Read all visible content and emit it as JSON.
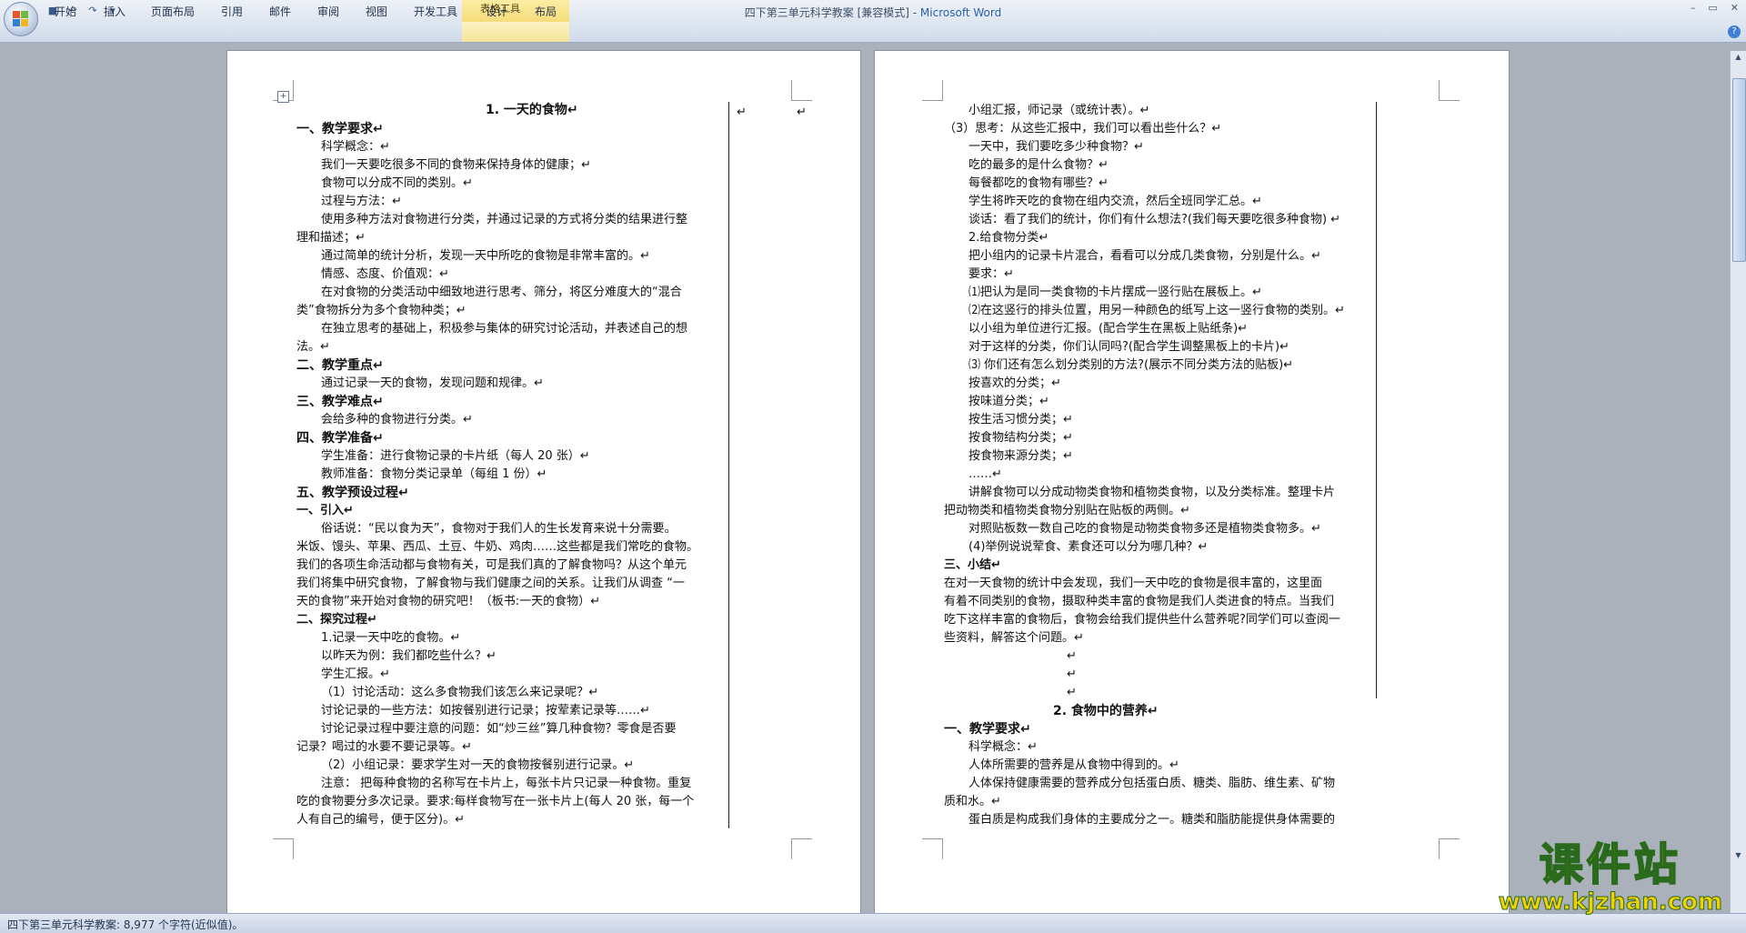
{
  "window": {
    "doc_name": "四下第三单元科学教案 [兼容模式] - ",
    "app_name": "Microsoft Word",
    "context_tab_group": "表格工具",
    "controls": {
      "minimize": "–",
      "maximize": "▭",
      "close": "✕"
    }
  },
  "qat": {
    "save": "■",
    "undo": "↶",
    "redo": "↷",
    "more": "▾"
  },
  "ribbon_tabs": [
    "开始",
    "插入",
    "页面布局",
    "引用",
    "邮件",
    "审阅",
    "视图",
    "开发工具",
    "设计",
    "布局"
  ],
  "help": "?",
  "move_handle": "+",
  "page1": {
    "title": "1.    一天的食物↵",
    "side_marks": [
      "↵",
      "↵"
    ],
    "lines": [
      {
        "t": "一、教学要求↵",
        "s": "h"
      },
      {
        "t": "科学概念：↵",
        "i": 1
      },
      {
        "t": "我们一天要吃很多不同的食物来保持身体的健康；↵",
        "i": 1
      },
      {
        "t": "食物可以分成不同的类别。↵",
        "i": 1
      },
      {
        "t": "过程与方法：↵",
        "i": 1
      },
      {
        "t": "使用多种方法对食物进行分类，并通过记录的方式将分类的结果进行整",
        "i": 1
      },
      {
        "t": "理和描述；↵"
      },
      {
        "t": "通过简单的统计分析，发现一天中所吃的食物是非常丰富的。↵",
        "i": 1
      },
      {
        "t": "情感、态度、价值观：↵",
        "i": 1
      },
      {
        "t": "在对食物的分类活动中细致地进行思考、筛分，将区分难度大的“混合",
        "i": 1
      },
      {
        "t": "类”食物拆分为多个食物种类；↵"
      },
      {
        "t": "在独立思考的基础上，积极参与集体的研究讨论活动，并表述自己的想",
        "i": 1
      },
      {
        "t": "法。↵"
      },
      {
        "t": "二、教学重点↵",
        "s": "h"
      },
      {
        "t": "通过记录一天的食物，发现问题和规律。↵",
        "i": 1
      },
      {
        "t": "三、教学难点↵",
        "s": "h"
      },
      {
        "t": "会给多种的食物进行分类。↵",
        "i": 1
      },
      {
        "t": "四、教学准备↵",
        "s": "h"
      },
      {
        "t": "学生准备：进行食物记录的卡片纸（每人 20 张）↵",
        "i": 1
      },
      {
        "t": "教师准备：食物分类记录单（每组 1 份）↵",
        "i": 1
      },
      {
        "t": "五、教学预设过程↵",
        "s": "h"
      },
      {
        "t": "一、引入↵",
        "s": "b"
      },
      {
        "t": "俗话说：“民以食为天”，食物对于我们人的生长发育来说十分需要。",
        "i": 1
      },
      {
        "t": "米饭、馒头、苹果、西瓜、土豆、牛奶、鸡肉……这些都是我们常吃的食物。"
      },
      {
        "t": "我们的各项生命活动都与食物有关，可是我们真的了解食物吗？从这个单元"
      },
      {
        "t": "我们将集中研究食物，了解食物与我们健康之间的关系。让我们从调查 “一"
      },
      {
        "t": "天的食物”来开始对食物的研究吧！（板书:一天的食物）↵"
      },
      {
        "t": "二、探究过程↵",
        "s": "b"
      },
      {
        "t": "1.记录一天中吃的食物。↵",
        "i": 1
      },
      {
        "t": "以昨天为例：我们都吃些什么？↵",
        "i": 1
      },
      {
        "t": "学生汇报。↵",
        "i": 1
      },
      {
        "t": "（1）讨论活动：这么多食物我们该怎么来记录呢？↵",
        "i": 1
      },
      {
        "t": "讨论记录的一些方法：如按餐别进行记录；按荤素记录等……↵",
        "i": 1
      },
      {
        "t": "讨论记录过程中要注意的问题：如“炒三丝”算几种食物？零食是否要",
        "i": 1
      },
      {
        "t": "记录？喝过的水要不要记录等。↵"
      },
      {
        "t": "（2）小组记录：要求学生对一天的食物按餐别进行记录。↵",
        "i": 1
      },
      {
        "t": "注意： 把每种食物的名称写在卡片上，每张卡片只记录一种食物。重复",
        "i": 1
      },
      {
        "t": "吃的食物要分多次记录。要求:每样食物写在一张卡片上(每人 20 张，每一个"
      },
      {
        "t": "人有自己的编号，便于区分)。↵"
      }
    ]
  },
  "page2": {
    "lines": [
      {
        "t": "小组汇报，师记录（或统计表）。↵",
        "i": 1
      },
      {
        "t": "（3）思考：从这些汇报中，我们可以看出些什么？↵"
      },
      {
        "t": "一天中，我们要吃多少种食物？↵",
        "i": 1
      },
      {
        "t": "吃的最多的是什么食物？↵",
        "i": 1
      },
      {
        "t": "每餐都吃的食物有哪些？↵",
        "i": 1
      },
      {
        "t": "学生将昨天吃的食物在组内交流，然后全班同学汇总。↵",
        "i": 1
      },
      {
        "t": "谈话：看了我们的统计，你们有什么想法?(我们每天要吃很多种食物) ↵",
        "i": 1
      },
      {
        "t": "2.给食物分类↵",
        "i": 1
      },
      {
        "t": "把小组内的记录卡片混合，看看可以分成几类食物，分别是什么。↵",
        "i": 1
      },
      {
        "t": "要求：↵",
        "i": 1
      },
      {
        "t": "⑴把认为是同一类食物的卡片摆成一竖行贴在展板上。↵",
        "i": 1
      },
      {
        "t": "⑵在这竖行的排头位置，用另一种颜色的纸写上这一竖行食物的类别。↵",
        "i": 1
      },
      {
        "t": " 以小组为单位进行汇报。(配合学生在黑板上贴纸条)↵",
        "i": 1
      },
      {
        "t": " 对于这样的分类，你们认同吗?(配合学生调整黑板上的卡片)↵",
        "i": 1
      },
      {
        "t": "⑶ 你们还有怎么划分类别的方法?(展示不同分类方法的贴板)↵",
        "i": 1
      },
      {
        "t": "按喜欢的分类；↵",
        "i": 1
      },
      {
        "t": "按味道分类；↵",
        "i": 1
      },
      {
        "t": "按生活习惯分类；↵",
        "i": 1
      },
      {
        "t": "按食物结构分类；↵",
        "i": 1
      },
      {
        "t": "按食物来源分类；↵",
        "i": 1
      },
      {
        "t": "……↵",
        "i": 1
      },
      {
        "t": "讲解食物可以分成动物类食物和植物类食物，以及分类标准。整理卡片",
        "i": 1
      },
      {
        "t": "把动物类和植物类食物分别贴在贴板的两侧。↵"
      },
      {
        "t": "对照贴板数一数自己吃的食物是动物类食物多还是植物类食物多。↵",
        "i": 1
      },
      {
        "t": "(4)举例说说荤食、素食还可以分为哪几种？↵",
        "i": 1
      },
      {
        "t": "三、小结↵",
        "s": "b"
      },
      {
        "t": "在对一天食物的统计中会发现，我们一天中吃的食物是很丰富的，这里面"
      },
      {
        "t": "有着不同类别的食物，摄取种类丰富的食物是我们人类进食的特点。当我们"
      },
      {
        "t": "吃下这样丰富的食物后，食物会给我们提供些什么营养呢?同学们可以查阅一"
      },
      {
        "t": "些资料，解答这个问题。↵"
      },
      {
        "t": "↵",
        "i": 5
      },
      {
        "t": "↵",
        "i": 5
      },
      {
        "t": "↵",
        "i": 5
      },
      {
        "t": "2.    食物中的营养↵",
        "s": "title"
      },
      {
        "t": "一、教学要求↵",
        "s": "h"
      },
      {
        "t": "科学概念：↵",
        "i": 1
      },
      {
        "t": "人体所需要的营养是从食物中得到的。↵",
        "i": 1
      },
      {
        "t": "人体保持健康需要的营养成分包括蛋白质、糖类、脂肪、维生素、矿物",
        "i": 1
      },
      {
        "t": "质和水。↵"
      },
      {
        "t": "蛋白质是构成我们身体的主要成分之一。糖类和脂肪能提供身体需要的",
        "i": 1
      }
    ]
  },
  "status_bar": "四下第三单元科学教案: 8,977 个字符(近似值)。",
  "watermark": {
    "main": "课件站",
    "url": "www.kjzhan.com"
  }
}
